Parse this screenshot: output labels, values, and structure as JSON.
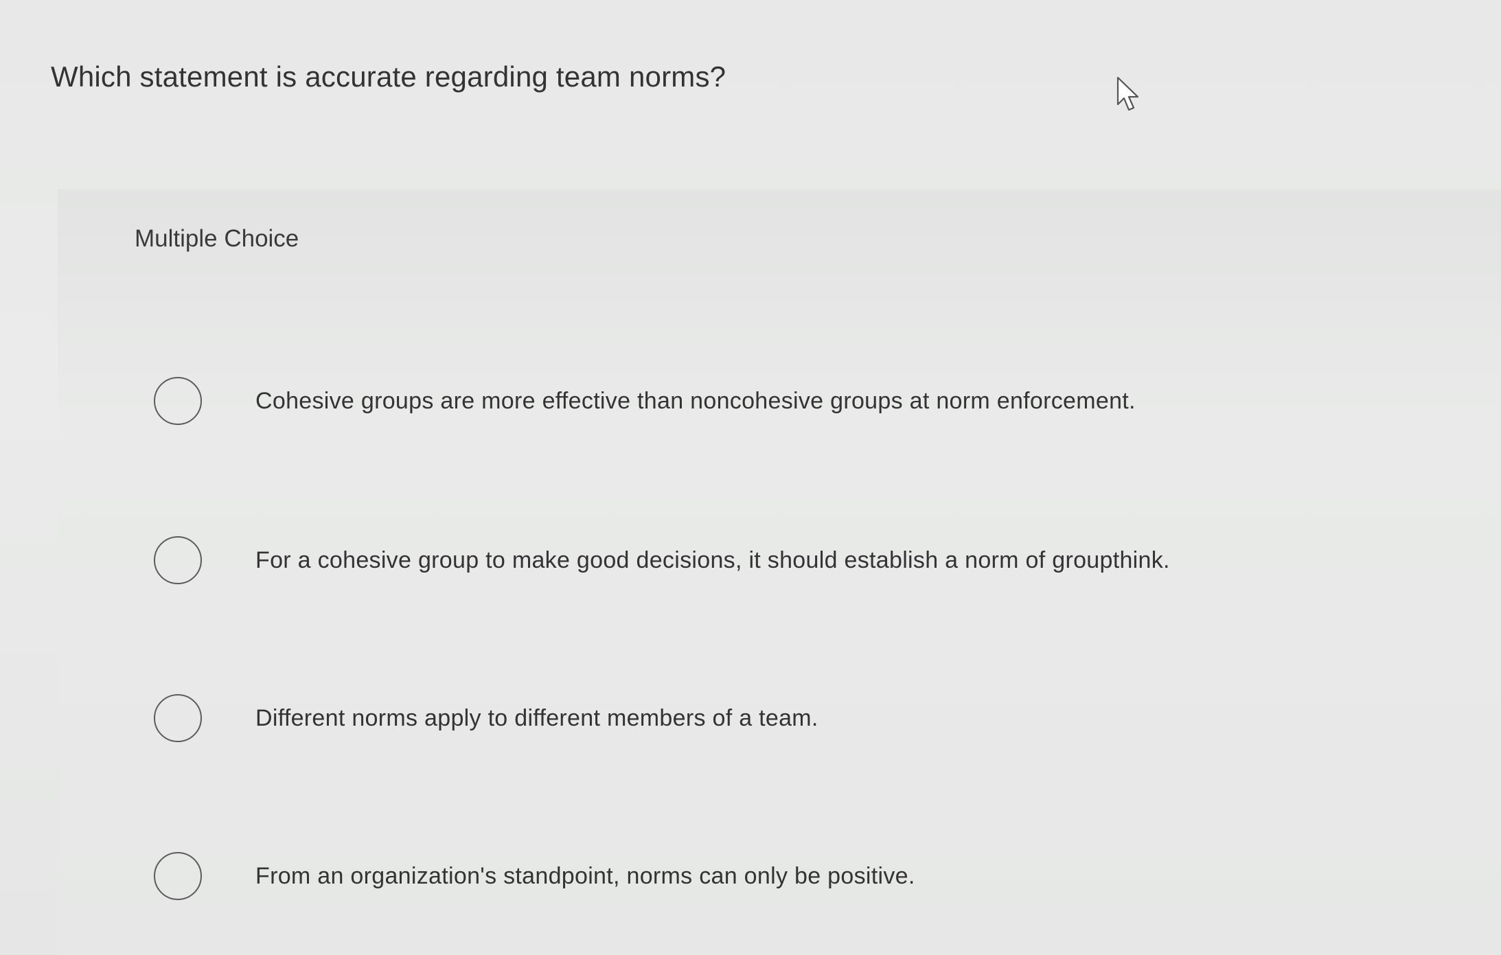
{
  "question": {
    "text": "Which statement is accurate regarding team norms?"
  },
  "quiz": {
    "type_label": "Multiple Choice",
    "options": [
      {
        "label": "Cohesive groups are more effective than noncohesive groups at norm enforcement.",
        "selected": false
      },
      {
        "label": "For a cohesive group to make good decisions, it should establish a norm of groupthink.",
        "selected": false
      },
      {
        "label": "Different norms apply to different members of a team.",
        "selected": false
      },
      {
        "label": "From an organization's standpoint, norms can only be positive.",
        "selected": false
      }
    ]
  },
  "icons": {
    "cursor": "mouse-pointer-icon",
    "radio": "radio-unselected-icon"
  }
}
